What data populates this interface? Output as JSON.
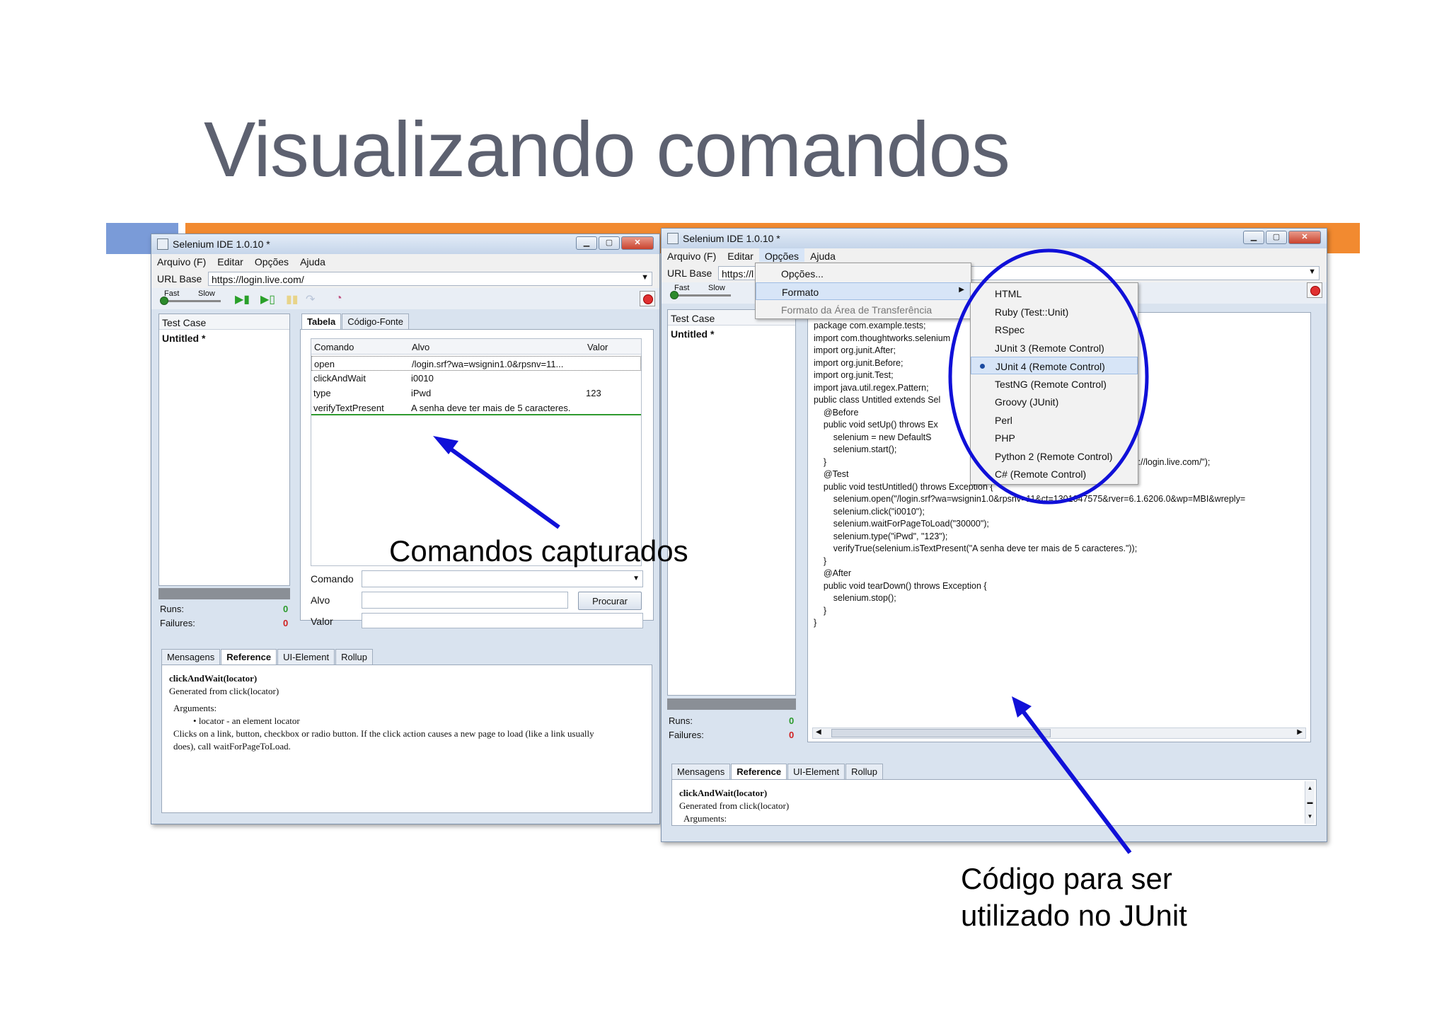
{
  "slide": {
    "title": "Visualizando comandos",
    "callout_left": "Comandos capturados",
    "callout_right_line1": "Código para ser",
    "callout_right_line2": "utilizado no JUnit"
  },
  "colors": {
    "title_gray": "#5d6170",
    "bar_blue": "#7a9bd8",
    "bar_orange": "#f28a30",
    "annotation_blue": "#1010d8"
  },
  "left_window": {
    "title": "Selenium IDE 1.0.10 *",
    "menu": [
      "Arquivo (F)",
      "Editar",
      "Opções",
      "Ajuda"
    ],
    "url_label": "URL Base",
    "url_value": "https://login.live.com/",
    "speed_fast": "Fast",
    "speed_slow": "Slow",
    "testcase_header": "Test Case",
    "testcase_item": "Untitled *",
    "runs_label": "Runs:",
    "runs_value": "0",
    "failures_label": "Failures:",
    "failures_value": "0",
    "tabs": [
      "Tabela",
      "Código-Fonte"
    ],
    "table_headers": [
      "Comando",
      "Alvo",
      "Valor"
    ],
    "table_rows": [
      {
        "cmd": "open",
        "target": "/login.srf?wa=wsignin1.0&rpsnv=11...",
        "value": ""
      },
      {
        "cmd": "clickAndWait",
        "target": "i0010",
        "value": ""
      },
      {
        "cmd": "type",
        "target": "iPwd",
        "value": "123"
      },
      {
        "cmd": "verifyTextPresent",
        "target": "A senha deve ter mais de 5 caracteres.",
        "value": ""
      }
    ],
    "form_comando": "Comando",
    "form_alvo": "Alvo",
    "form_valor": "Valor",
    "find_button": "Procurar",
    "bottom_tabs": [
      "Mensagens",
      "Reference",
      "UI-Element",
      "Rollup"
    ],
    "ref_sig": "clickAndWait(locator)",
    "ref_generated": "Generated from click(locator)",
    "ref_args": "Arguments:",
    "ref_locator": "locator - an element locator",
    "ref_desc1": "Clicks on a link, button, checkbox or radio button. If the click action causes a new page to load (like a link usually",
    "ref_desc2": "does), call waitForPageToLoad."
  },
  "right_window": {
    "title": "Selenium IDE 1.0.10 *",
    "menu": [
      "Arquivo (F)",
      "Editar",
      "Opções",
      "Ajuda"
    ],
    "url_label": "URL Base",
    "url_value": "https://l",
    "speed_fast": "Fast",
    "speed_slow": "Slow",
    "testcase_header": "Test Case",
    "testcase_item": "Untitled *",
    "runs_label": "Runs:",
    "runs_value": "0",
    "failures_label": "Failures:",
    "failures_value": "0",
    "options_menu": [
      "Opções...",
      "Formato",
      "Formato da Área de Transferência"
    ],
    "format_submenu": [
      "HTML",
      "Ruby (Test::Unit)",
      "RSpec",
      "JUnit 3 (Remote Control)",
      "JUnit 4 (Remote Control)",
      "TestNG (Remote Control)",
      "Groovy (JUnit)",
      "Perl",
      "PHP",
      "Python 2 (Remote Control)",
      "C# (Remote Control)"
    ],
    "code_lines": [
      "package com.example.tests;",
      "",
      "import com.thoughtworks.selenium",
      "import org.junit.After;",
      "import org.junit.Before;",
      "import org.junit.Test;",
      "import java.util.regex.Pattern;",
      "",
      "public class Untitled extends Sel",
      "    @Before",
      "    public void setUp() throws Ex",
      "        selenium = new DefaultS",
      "        selenium.start();",
      "    }",
      "",
      "    @Test",
      "    public void testUntitled() throws Exception {",
      "        selenium.open(\"/login.srf?wa=wsignin1.0&rpsnv=11&ct=1301047575&rver=6.1.6206.0&wp=MBI&wreply=",
      "        selenium.click(\"i0010\");",
      "        selenium.waitForPageToLoad(\"30000\");",
      "        selenium.type(\"iPwd\", \"123\");",
      "        verifyTrue(selenium.isTextPresent(\"A senha deve ter mais de 5 caracteres.\"));",
      "    }",
      "",
      "    @After",
      "    public void tearDown() throws Exception {",
      "        selenium.stop();",
      "    }",
      "}"
    ],
    "code_url_tail": "tps://login.live.com/\");",
    "bottom_tabs": [
      "Mensagens",
      "Reference",
      "UI-Element",
      "Rollup"
    ],
    "ref_sig": "clickAndWait(locator)",
    "ref_generated": "Generated from click(locator)",
    "ref_args": "Arguments:"
  }
}
